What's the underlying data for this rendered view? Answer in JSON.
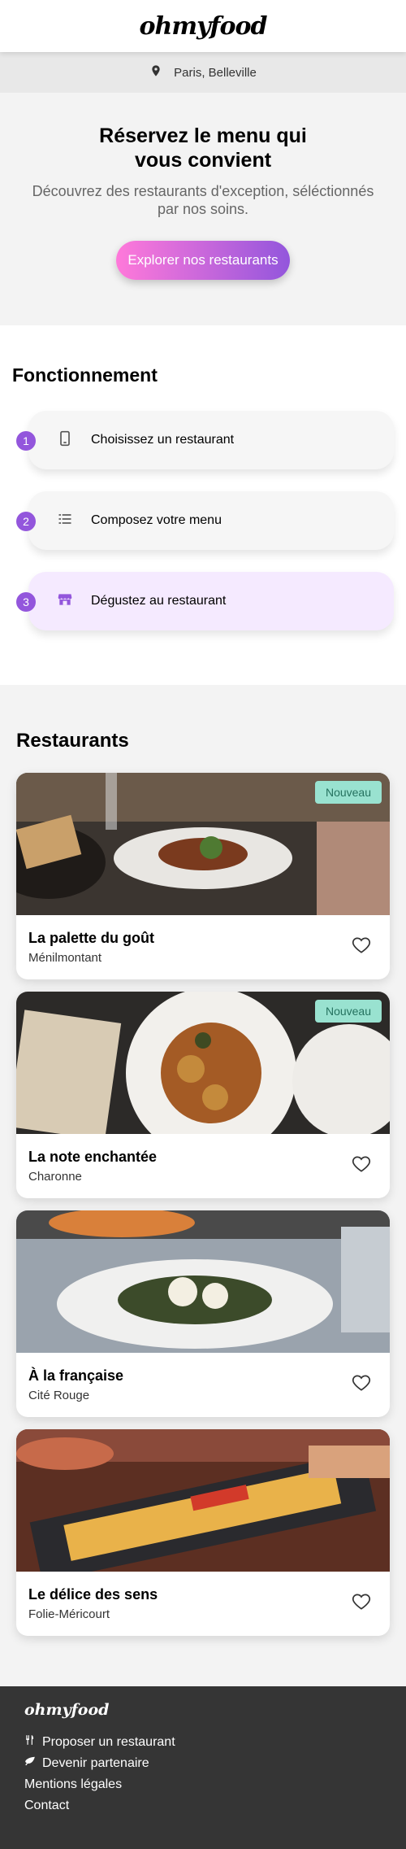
{
  "header": {
    "logo": "ohmyfood"
  },
  "location": {
    "text": "Paris, Belleville",
    "icon": "map-pin-icon"
  },
  "hero": {
    "title": "Réservez le menu qui vous convient",
    "subtitle": "Découvrez des restaurants d'exception, séléctionnés par nos soins.",
    "cta": "Explorer nos restaurants",
    "cta_gradient": [
      "#ff79da",
      "#9356dc"
    ]
  },
  "how": {
    "title": "Fonctionnement",
    "steps": [
      {
        "num": "1",
        "label": "Choisissez un restaurant",
        "icon": "mobile-phone-icon"
      },
      {
        "num": "2",
        "label": "Composez votre menu",
        "icon": "list-icon"
      },
      {
        "num": "3",
        "label": "Dégustez au restaurant",
        "icon": "store-icon"
      }
    ]
  },
  "restaurants": {
    "title": "Restaurants",
    "items": [
      {
        "name": "La palette du goût",
        "area": "Ménilmontant",
        "badge": "Nouveau"
      },
      {
        "name": "La note enchantée",
        "area": "Charonne",
        "badge": "Nouveau"
      },
      {
        "name": "À la française",
        "area": "Cité Rouge",
        "badge": ""
      },
      {
        "name": "Le délice des sens",
        "area": "Folie-Méricourt",
        "badge": ""
      }
    ]
  },
  "footer": {
    "logo": "ohmyfood",
    "links": [
      {
        "label": "Proposer un restaurant",
        "icon": "utensils-icon"
      },
      {
        "label": "Devenir partenaire",
        "icon": "handshake-icon"
      },
      {
        "label": "Mentions légales",
        "icon": ""
      },
      {
        "label": "Contact",
        "icon": ""
      }
    ]
  },
  "colors": {
    "accent": "#9356dc",
    "badge_bg": "#99e2d0",
    "footer_bg": "#353535"
  }
}
